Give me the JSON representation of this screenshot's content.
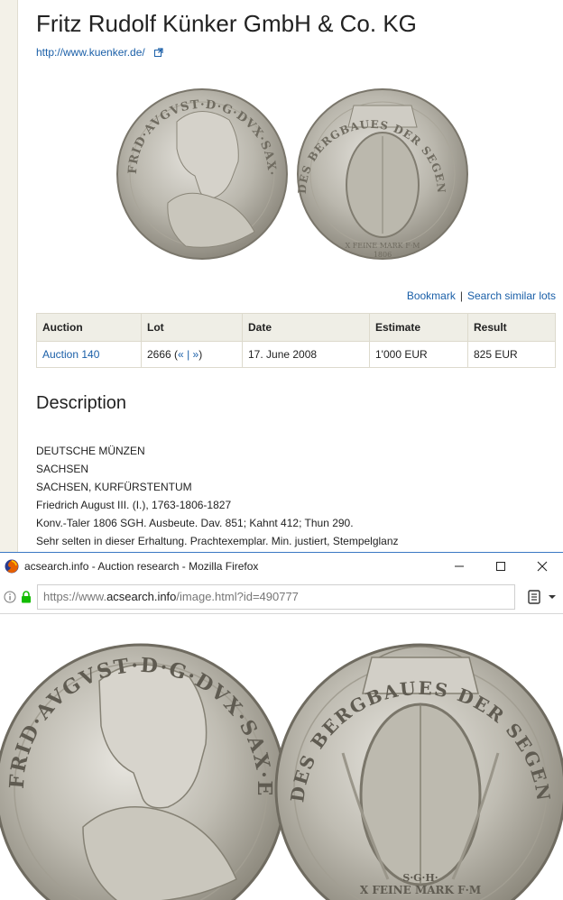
{
  "page": {
    "company_title": "Fritz Rudolf Künker GmbH & Co. KG",
    "company_url": "http://www.kuenker.de/",
    "links": {
      "bookmark": "Bookmark",
      "separator": "|",
      "search_similar": "Search similar lots"
    },
    "table": {
      "headers": [
        "Auction",
        "Lot",
        "Date",
        "Estimate",
        "Result"
      ],
      "row": {
        "auction": "Auction 140",
        "lot_number": "2666",
        "lot_prev": "«",
        "lot_sep": "|",
        "lot_next": "»",
        "date": "17. June 2008",
        "estimate": "1'000 EUR",
        "result": "825 EUR"
      }
    },
    "description_title": "Description",
    "description_lines": [
      "DEUTSCHE MÜNZEN",
      "SACHSEN",
      "SACHSEN, KURFÜRSTENTUM",
      "Friedrich August III. (I.), 1763-1806-1827",
      "Konv.-Taler 1806 SGH. Ausbeute. Dav. 851; Kahnt 412; Thun 290.",
      "Sehr selten in dieser Erhaltung. Prachtexemplar. Min. justiert, Stempelglanz"
    ]
  },
  "coin": {
    "obverse_legend": "FRID·AVGVST·D·G·DVX·SAX·ELECTOR",
    "reverse_legend": "DES BERGBAUES DER SEGEN",
    "reverse_bottom_mint": "S·G·H·",
    "reverse_bottom": "X FEINE MARK F·M",
    "reverse_year": "1806"
  },
  "popup": {
    "window_title": "acsearch.info - Auction research - Mozilla Firefox",
    "url_prefix": "https://www.",
    "url_host": "acsearch.info",
    "url_path": "/image.html?id=490777",
    "icons": [
      "firefox-icon",
      "minimize-icon",
      "maximize-icon",
      "close-icon",
      "info-icon",
      "lock-icon",
      "reader-view-icon",
      "menu-arrow-icon",
      "external-link-icon"
    ]
  },
  "colors": {
    "link": "#1a5fa8",
    "table_header": "#efeee6",
    "rail": "#f3f1e8",
    "window_accent": "#3a78c4"
  }
}
